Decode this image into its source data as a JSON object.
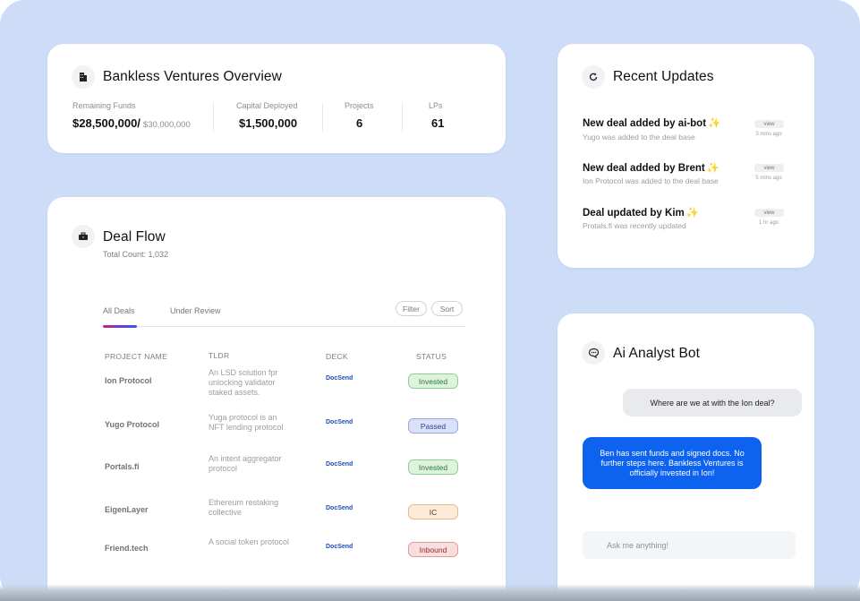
{
  "overview": {
    "title": "Bankless Ventures Overview",
    "stats": [
      {
        "label": "Remaining Funds",
        "value": "$28,500,000/",
        "sub": "$30,000,000"
      },
      {
        "label": "Capital Deployed",
        "value": "$1,500,000"
      },
      {
        "label": "Projects",
        "value": "6"
      },
      {
        "label": "LPs",
        "value": "61"
      }
    ]
  },
  "dealflow": {
    "title": "Deal Flow",
    "total": "Total Count: 1,032",
    "tabs": [
      "All Deals",
      "Under Review"
    ],
    "filter_label": "Filter",
    "sort_label": "Sort",
    "columns": [
      "PROJECT NAME",
      "TLDR",
      "DECK",
      "STATUS"
    ],
    "rows": [
      {
        "name": "Ion Protocol",
        "tldr": "An LSD solution fpr unlocking validator staked assets.",
        "deck": "DocSend",
        "status": "Invested",
        "status_bg": "#dcf3dc",
        "status_border": "#8fd08f",
        "status_color": "#2f7a2f"
      },
      {
        "name": "Yugo Protocol",
        "tldr": "Yuga protocol is an NFT lending protocol",
        "deck": "DocSend",
        "status": "Passed",
        "status_bg": "#dbe1f8",
        "status_border": "#96a6e6",
        "status_color": "#2f3f8a"
      },
      {
        "name": "Portals.fi",
        "tldr": "An intent aggregator protocol",
        "deck": "DocSend",
        "status": "Invested",
        "status_bg": "#dcf3dc",
        "status_border": "#8fd08f",
        "status_color": "#2f7a2f"
      },
      {
        "name": "EigenLayer",
        "tldr": "Ethereum restaking collective",
        "deck": "DocSend",
        "status": "IC",
        "status_bg": "#fcebd9",
        "status_border": "#e5b98c",
        "status_color": "#5a3a1a"
      },
      {
        "name": "Friend.tech",
        "tldr": "A social token protocol",
        "deck": "DocSend",
        "status": "Inbound",
        "status_bg": "#f9dede",
        "status_border": "#e49a9a",
        "status_color": "#9a2a2a"
      }
    ]
  },
  "updates": {
    "title": "Recent Updates",
    "view_label": "view",
    "items": [
      {
        "title": "New deal added by ai-bot",
        "spark": "✨",
        "sub": "Yugo was added to the deal base",
        "ago": "3 mins ago"
      },
      {
        "title": "New deal added by Brent",
        "spark": "✨",
        "sub": "Ion Protocol was added to the deal base",
        "ago": "5 mins ago"
      },
      {
        "title": "Deal updated by Kim",
        "spark": "✨",
        "sub": "Protals.fi was recently updated",
        "ago": "1 hr ago"
      }
    ]
  },
  "aibot": {
    "title": "Ai Analyst Bot",
    "user_message": "Where are we at with the Ion deal?",
    "bot_message": "Ben has sent funds and signed docs. No further steps here. Bankless Ventures is officially invested in Ion!",
    "input_placeholder": "Ask me anything!"
  }
}
